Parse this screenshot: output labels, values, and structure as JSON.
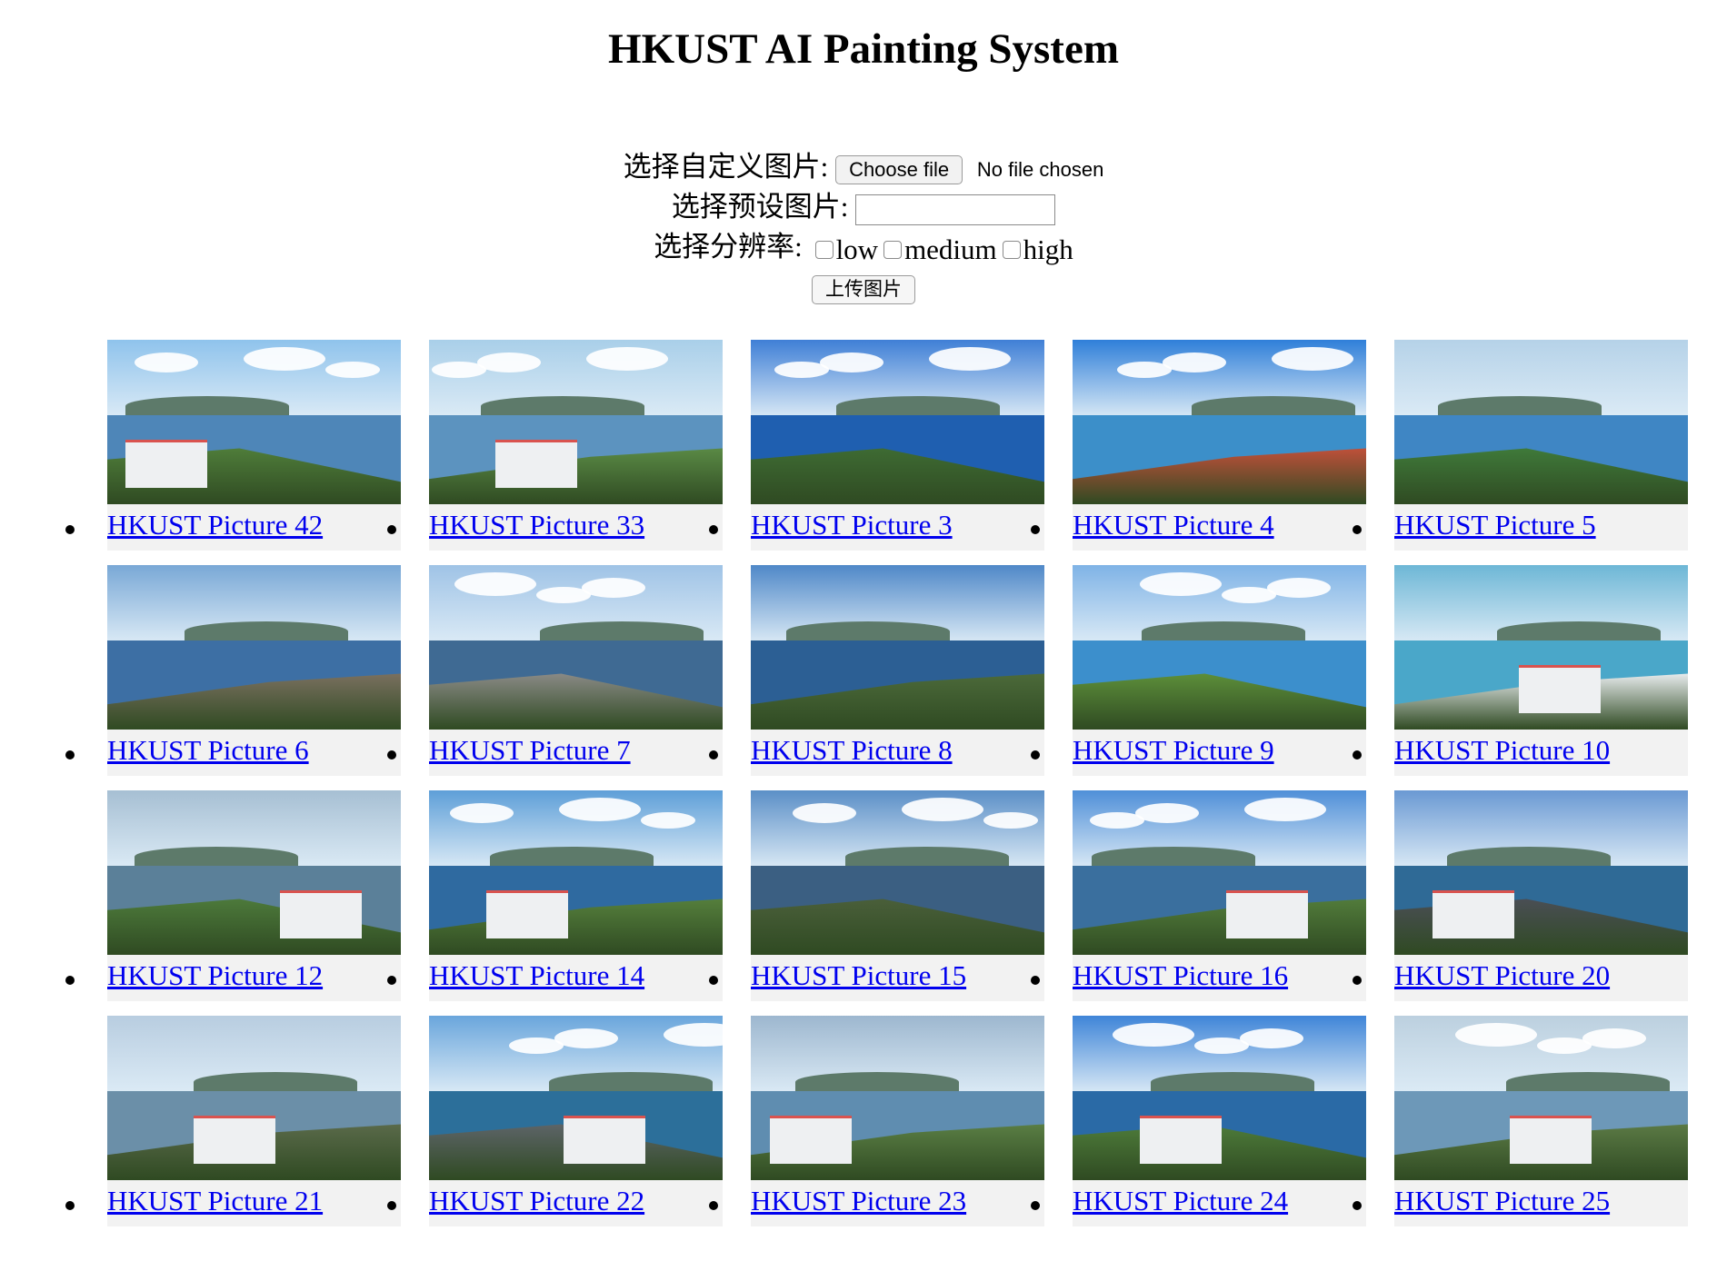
{
  "page": {
    "title": "HKUST AI Painting System"
  },
  "form": {
    "custom_image_label": "选择自定义图片:",
    "choose_file_label": "Choose file",
    "file_status": "No file chosen",
    "preset_image_label": "选择预设图片:",
    "preset_value": "",
    "resolution_label": "选择分辨率:",
    "resolution_options": [
      "low",
      "medium",
      "high"
    ],
    "upload_label": "上传图片"
  },
  "gallery": {
    "items": [
      {
        "label": "HKUST Picture 42",
        "sky": "#8fc3ec",
        "sea": "#4e86b8",
        "land": "#4f7d3a",
        "cloud": true,
        "building": true
      },
      {
        "label": "HKUST Picture 33",
        "sky": "#a9cfe9",
        "sea": "#5c93bf",
        "land": "#5a8a45",
        "cloud": true,
        "building": true
      },
      {
        "label": "HKUST Picture 3",
        "sky": "#3f7fd6",
        "sea": "#1f5fb0",
        "land": "#3e6b33",
        "cloud": true,
        "building": false
      },
      {
        "label": "HKUST Picture 4",
        "sky": "#2f7fd9",
        "sea": "#3c8fc9",
        "land": "#c0503a",
        "cloud": true,
        "building": false
      },
      {
        "label": "HKUST Picture 5",
        "sky": "#b5d2e8",
        "sea": "#3f86c4",
        "land": "#3f7a3a",
        "cloud": false,
        "building": false
      },
      {
        "label": "HKUST Picture 6",
        "sky": "#79a8d6",
        "sea": "#3d6fa4",
        "land": "#7a7060",
        "cloud": false,
        "building": false
      },
      {
        "label": "HKUST Picture 7",
        "sky": "#9fc3e6",
        "sea": "#3f6a93",
        "land": "#8a8a86",
        "cloud": true,
        "building": false
      },
      {
        "label": "HKUST Picture 8",
        "sky": "#4f88c8",
        "sea": "#2c5f94",
        "land": "#4c6a3a",
        "cloud": false,
        "building": false
      },
      {
        "label": "HKUST Picture 9",
        "sky": "#7fb3e6",
        "sea": "#3c8fcc",
        "land": "#5d8f3a",
        "cloud": true,
        "building": false
      },
      {
        "label": "HKUST Picture 10",
        "sky": "#6db7d6",
        "sea": "#4aa7c9",
        "land": "#e8ecee",
        "cloud": false,
        "building": true
      },
      {
        "label": "HKUST Picture 12",
        "sky": "#a6bfd3",
        "sea": "#5b8099",
        "land": "#4d7a3b",
        "cloud": false,
        "building": true
      },
      {
        "label": "HKUST Picture 14",
        "sky": "#5e9fd8",
        "sea": "#2f6aa0",
        "land": "#557f3c",
        "cloud": true,
        "building": true
      },
      {
        "label": "HKUST Picture 15",
        "sky": "#5b8fc7",
        "sea": "#3b5f82",
        "land": "#4a5f3a",
        "cloud": true,
        "building": false
      },
      {
        "label": "HKUST Picture 16",
        "sky": "#4f8fd8",
        "sea": "#3a6f9e",
        "land": "#527c3b",
        "cloud": true,
        "building": true
      },
      {
        "label": "HKUST Picture 20",
        "sky": "#6a99d3",
        "sea": "#2f6a96",
        "land": "#4a4e55",
        "cloud": false,
        "building": true
      },
      {
        "label": "HKUST Picture 21",
        "sky": "#b8cde0",
        "sea": "#6b8fa8",
        "land": "#5a6a4a",
        "cloud": false,
        "building": true
      },
      {
        "label": "HKUST Picture 22",
        "sky": "#6aa6dc",
        "sea": "#2c6f9a",
        "land": "#5d6468",
        "cloud": true,
        "building": true
      },
      {
        "label": "HKUST Picture 23",
        "sky": "#9db7cf",
        "sea": "#5f8db0",
        "land": "#5a7e44",
        "cloud": false,
        "building": true
      },
      {
        "label": "HKUST Picture 24",
        "sky": "#3f85d8",
        "sea": "#2a6aa6",
        "land": "#4e7c3a",
        "cloud": true,
        "building": true
      },
      {
        "label": "HKUST Picture 25",
        "sky": "#bcd0df",
        "sea": "#6d98b8",
        "land": "#5b7a45",
        "cloud": true,
        "building": true
      }
    ]
  }
}
